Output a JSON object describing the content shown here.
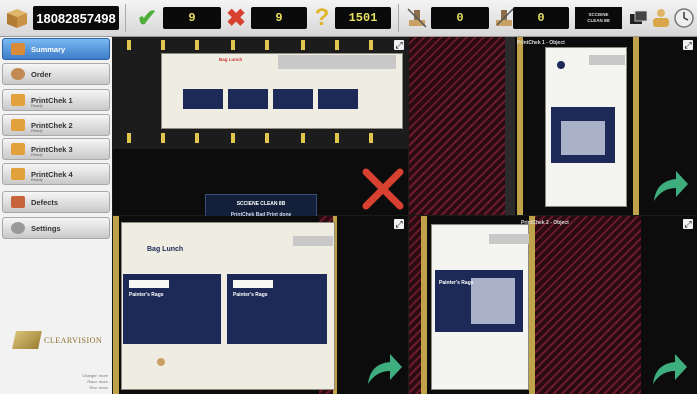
{
  "toolbar": {
    "barcode": "18082857498",
    "pass_count": "9",
    "fail_count": "9",
    "unknown_count": "1501",
    "counter_a": "0",
    "counter_b": "0",
    "status_line1": "SCCIENE",
    "status_line2": "CLEAN 8B"
  },
  "sidebar": {
    "items": [
      {
        "label": "Summary",
        "sub": "",
        "color": "#d98b3a"
      },
      {
        "label": "Order",
        "sub": "",
        "color": "#c28a52"
      },
      {
        "label": "PrintChek 1",
        "sub": "Ready",
        "color": "#e2a13a"
      },
      {
        "label": "PrintChek 2",
        "sub": "Ready",
        "color": "#e2a13a"
      },
      {
        "label": "PrintChek 3",
        "sub": "Ready",
        "color": "#e2a13a"
      },
      {
        "label": "PrintChek 4",
        "sub": "Ready",
        "color": "#e2a13a"
      },
      {
        "label": "Defects",
        "sub": "",
        "color": "#c7643c"
      },
      {
        "label": "Settings",
        "sub": "",
        "color": "#9a9a9a"
      }
    ],
    "logo_text": "CLEARVISION",
    "info_lines": [
      "Charger: more",
      "Raco: more",
      "Rev: more"
    ]
  },
  "panes": {
    "top_left": {
      "popup_line1": "SCCIENE CLEAN 8B",
      "popup_line2": "PrintChek Bad Print done"
    },
    "top_right": {
      "title": "PrintChek 1 - Object"
    },
    "bottom_right": {
      "title": "PrintChek 2 - Object"
    },
    "product_header": "Bag Lunch",
    "product_name": "Painter's Rags"
  },
  "colors": {
    "accent_blue": "#3d7cc9",
    "pass_green": "#4fae3a",
    "fail_red": "#d8402f",
    "arrow_green": "#3fae7f"
  }
}
